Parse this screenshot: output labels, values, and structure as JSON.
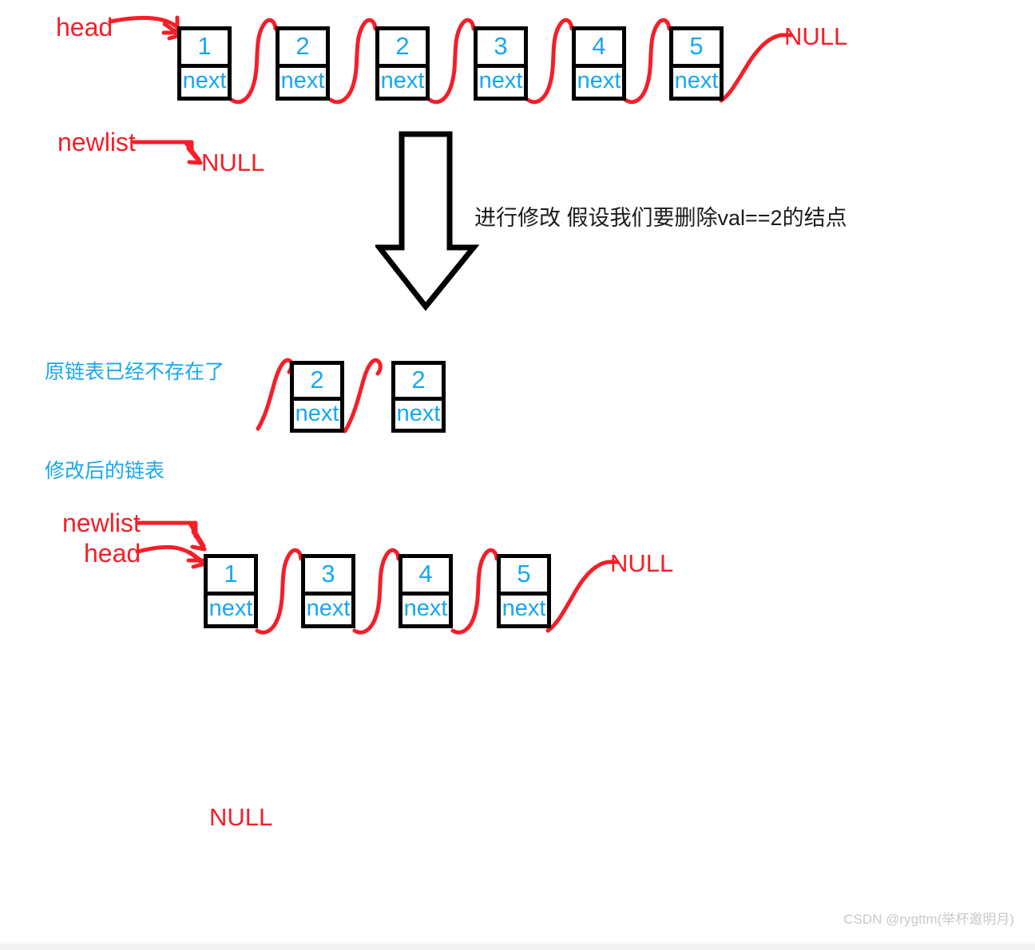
{
  "diagram": {
    "title": "linked-list remove-elements illustration",
    "colors": {
      "node_text": "#17A7F0",
      "pointer_red": "#F51E28",
      "node_border": "#000000",
      "annotation_blue": "#17A7F0",
      "annotation_black": "#1b1b1b",
      "watermark": "#c9c9c9"
    },
    "node_next_label": "next",
    "original_list": {
      "head_label": "head",
      "newlist_label": "newlist",
      "newlist_target": "NULL",
      "tail_null": "NULL",
      "values": [
        "1",
        "2",
        "2",
        "3",
        "4",
        "5"
      ]
    },
    "transition": {
      "note": "进行修改 假设我们要删除val==2的结点"
    },
    "removed_nodes": {
      "caption": "原链表已经不存在了",
      "values": [
        "2",
        "2"
      ]
    },
    "result_list": {
      "caption": "修改后的链表",
      "newlist_label": "newlist",
      "head_label": "head",
      "tail_null": "NULL",
      "values": [
        "1",
        "3",
        "4",
        "5"
      ]
    },
    "stray_null": "NULL",
    "watermark": "CSDN @rygttm(举杯邀明月)"
  }
}
